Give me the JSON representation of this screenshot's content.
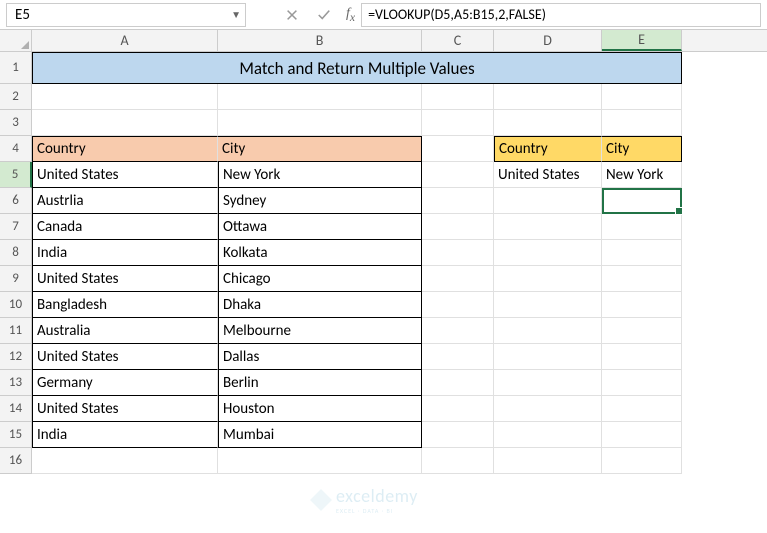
{
  "name_box": "E5",
  "formula": "=VLOOKUP(D5,A5:B15,2,FALSE)",
  "columns": [
    "A",
    "B",
    "C",
    "D",
    "E"
  ],
  "rows": [
    1,
    2,
    3,
    4,
    5,
    6,
    7,
    8,
    9,
    10,
    11,
    12,
    13,
    14,
    15,
    16
  ],
  "selected_cell": "E5",
  "title": "Match and Return Multiple Values",
  "table_headers": {
    "country": "Country",
    "city": "City"
  },
  "table_rows": [
    {
      "country": "United States",
      "city": "New York"
    },
    {
      "country": "Austrlia",
      "city": "Sydney"
    },
    {
      "country": "Canada",
      "city": "Ottawa"
    },
    {
      "country": "India",
      "city": "Kolkata"
    },
    {
      "country": "United States",
      "city": "Chicago"
    },
    {
      "country": "Bangladesh",
      "city": "Dhaka"
    },
    {
      "country": "Australia",
      "city": "Melbourne"
    },
    {
      "country": "United States",
      "city": "Dallas"
    },
    {
      "country": "Germany",
      "city": "Berlin"
    },
    {
      "country": "United States",
      "city": "Houston"
    },
    {
      "country": "India",
      "city": "Mumbai"
    }
  ],
  "lookup": {
    "headers": {
      "country": "Country",
      "city": "City"
    },
    "result": {
      "country": "United States",
      "city": "New York"
    }
  },
  "watermark": {
    "brand": "exceldemy",
    "sub": "EXCEL · DATA · BI"
  }
}
